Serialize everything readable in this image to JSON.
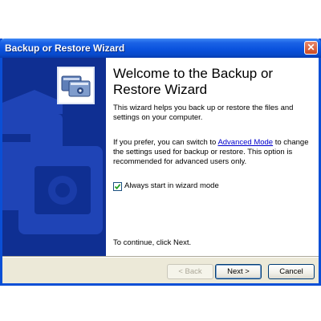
{
  "window": {
    "title": "Backup or Restore Wizard",
    "close_glyph": "✕"
  },
  "sidebar": {
    "hero_icon": "backup-cards-icon",
    "colors": {
      "background": "#0f2f92",
      "decoration": "#1f44b6"
    }
  },
  "content": {
    "title": "Welcome to the Backup or Restore Wizard",
    "intro": "This wizard helps you back up or restore the files and settings on your computer.",
    "prefer_before_link": "If you prefer, you can switch to ",
    "advanced_mode_link": "Advanced Mode",
    "prefer_after_link": " to change the settings used for backup or restore. This option is recommended for advanced users only.",
    "checkbox": {
      "label": "Always start in wizard mode",
      "checked": true
    },
    "continue_text": "To continue, click Next."
  },
  "buttons": {
    "back": "< Back",
    "next": "Next >",
    "cancel": "Cancel"
  },
  "colors": {
    "titlebar": "#0a52de",
    "checkmark": "#21a121",
    "link": "#0000cc"
  }
}
